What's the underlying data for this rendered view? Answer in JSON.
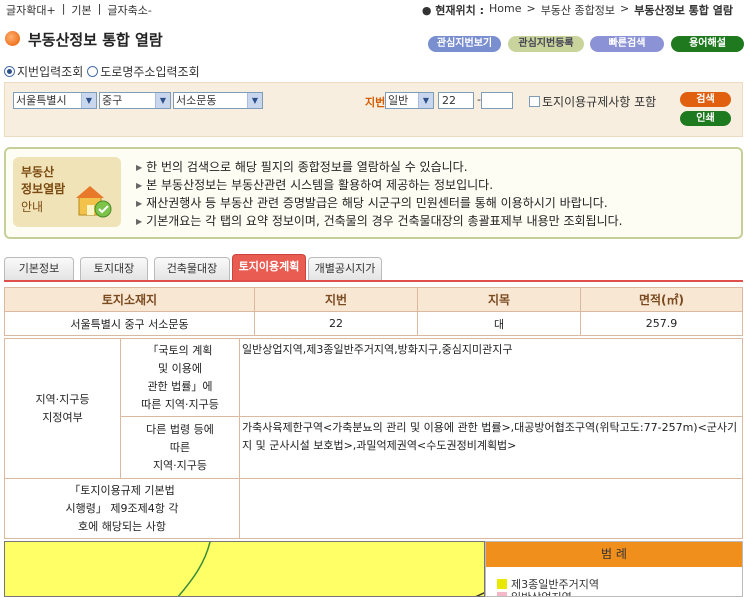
{
  "topbar": {
    "font_larger": "글자확대+",
    "font_default": "기본",
    "font_smaller": "글자축소-",
    "location_label": "● 현재위치 :",
    "crumbs": [
      "Home",
      "부동산 종합정보",
      "부동산정보 통합 열람"
    ],
    "crumb_sep": ">"
  },
  "page": {
    "title": "부동산정보 통합 열람",
    "buttons": {
      "interest_view": "관심지번보기",
      "interest_register": "관심지번등록",
      "quick_search": "빠른검색",
      "glossary": "용어해설"
    }
  },
  "search": {
    "mode_jibun": "지번입력조회",
    "mode_road": "도로명주소입력조회",
    "sido": "서울특별시",
    "sigungu": "중구",
    "dong": "서소문동",
    "jibun_label": "지번",
    "jibun_type": "일반",
    "bonbun": "22",
    "bubun": "",
    "include_land_use": "토지이용규제사항 포함",
    "search_button": "검색",
    "print_button": "인쇄"
  },
  "guide": {
    "badge_lines": [
      "부동산",
      "정보열람",
      "안내"
    ],
    "items": [
      "한 번의 검색으로 해당 필지의 종합정보를 열람하실 수 있습니다.",
      "본 부동산정보는 부동산관련 시스템을 활용하여 제공하는 정보입니다.",
      "재산권행사 등 부동산 관련 증명발급은 해당 시군구의 민원센터를 통해 이용하시기 바랍니다.",
      "기본개요는 각 탭의 요약 정보이며, 건축물의 경우 건축물대장의 총괄표제부 내용만 조회됩니다."
    ]
  },
  "tabs": [
    "기본정보",
    "토지대장",
    "건축물대장",
    "토지이용계획",
    "개별공시지가"
  ],
  "land_table": {
    "headers": [
      "토지소재지",
      "지번",
      "지목",
      "면적(㎡)"
    ],
    "row": [
      "서울특별시 중구 서소문동",
      "22",
      "대",
      "257.9"
    ]
  },
  "detail": {
    "zone_label": "지역·지구등\n지정여부",
    "national_law_label": "「국토의 계획\n및 이용에\n관한 법률」에\n따른 지역·지구등",
    "national_law_value": "일반상업지역,제3종일반주거지역,방화지구,중심지미관지구",
    "other_law_label": "다른 법령 등에\n따른\n지역·지구등",
    "other_law_value": "가축사육제한구역<가축분뇨의 관리 및 이용에 관한 법률>,대공방어협조구역(위탁고도:77-257m)<군사기지 및 군사시설 보호법>,과밀억제권역<수도권정비계획법>",
    "framework_label": "「토지이용규제 기본법\n시행령」 제9조제4항 각\n호에 해당되는 사항",
    "framework_value": ""
  },
  "legend": {
    "title": "범 례",
    "items": [
      {
        "label": "제3종일반주거지역",
        "color": "#e8e800"
      },
      {
        "label": "일반상업지역",
        "color": "#f4b8c8"
      }
    ]
  },
  "colors": {
    "accent": "#e85c52",
    "header_bg": "#f8e7d2",
    "search_bg": "#f7eedf",
    "map_yellow": "#ffff66",
    "legend_orange": "#f08f1c"
  }
}
